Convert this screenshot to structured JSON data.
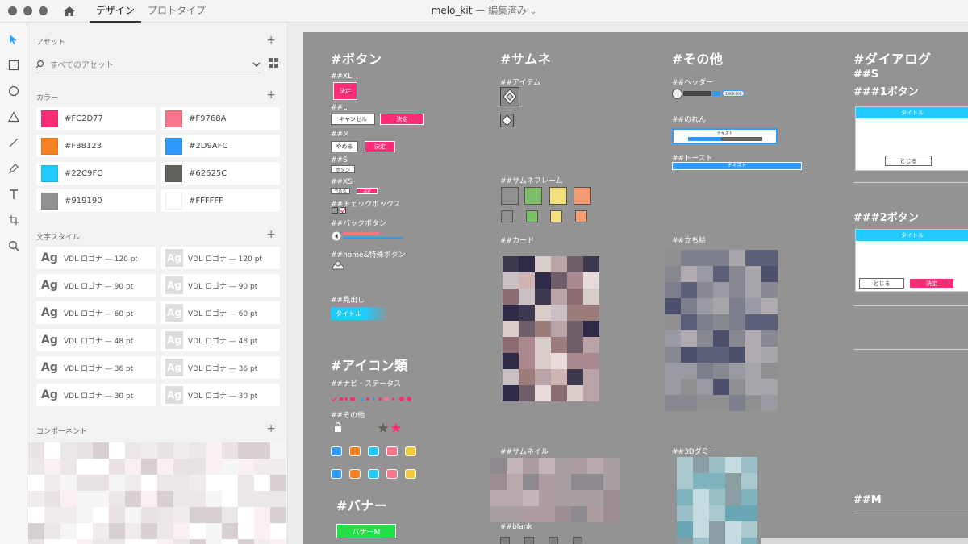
{
  "titlebar": {
    "tabs": [
      "デザイン",
      "プロトタイプ"
    ],
    "doc_name": "melo_kit",
    "separator": "—",
    "doc_state": "編集済み"
  },
  "tools": [
    "select-tool",
    "rectangle-tool",
    "ellipse-tool",
    "polygon-tool",
    "line-tool",
    "pen-tool",
    "text-tool",
    "artboard-tool",
    "zoom-tool"
  ],
  "panel": {
    "assets_title": "アセット",
    "search_placeholder": "すべてのアセット",
    "colors_title": "カラー",
    "colors": [
      {
        "hex": "#FC2D77"
      },
      {
        "hex": "#F9768A"
      },
      {
        "hex": "#F88123"
      },
      {
        "hex": "#2D9AFC"
      },
      {
        "hex": "#22C9FC"
      },
      {
        "hex": "#62625C"
      },
      {
        "hex": "#919190"
      },
      {
        "hex": "#FFFFFF"
      }
    ],
    "text_styles_title": "文字スタイル",
    "text_styles": [
      {
        "ag": "Ag",
        "label": "VDL ロゴナ — 120 pt"
      },
      {
        "ag": "Ag",
        "label": "VDL ロゴナ — 120 pt"
      },
      {
        "ag": "Ag",
        "label": "VDL ロゴナ — 90 pt"
      },
      {
        "ag": "Ag",
        "label": "VDL ロゴナ — 90 pt"
      },
      {
        "ag": "Ag",
        "label": "VDL ロゴナ — 60 pt"
      },
      {
        "ag": "Ag",
        "label": "VDL ロゴナ — 60 pt"
      },
      {
        "ag": "Ag",
        "label": "VDL ロゴナ — 48 pt"
      },
      {
        "ag": "Ag",
        "label": "VDL ロゴナ — 48 pt"
      },
      {
        "ag": "Ag",
        "label": "VDL ロゴナ — 36 pt"
      },
      {
        "ag": "Ag",
        "label": "VDL ロゴナ — 36 pt"
      },
      {
        "ag": "Ag",
        "label": "VDL ロゴナ — 30 pt"
      },
      {
        "ag": "Ag",
        "label": "VDL ロゴナ — 30 pt"
      }
    ],
    "components_title": "コンポーネント"
  },
  "canvas": {
    "button_section": {
      "title": "#ボタン",
      "xl": "##XL",
      "xl_btn": "決定",
      "l": "##L",
      "l_cancel": "キャンセル",
      "l_ok": "決定",
      "m": "##M",
      "m_stop": "やめる",
      "m_ok": "決定",
      "s": "##S",
      "s_btn": "ボタン",
      "xs": "##XS",
      "xs_stop": "やめる",
      "xs_ok": "決定",
      "checkbox": "##チェックボックス",
      "back": "##バックボタン",
      "home": "##home&特殊ボタン",
      "heading": "##見出し",
      "heading_label": "タイトル"
    },
    "icon_section": {
      "title": "#アイコン類",
      "nav": "##ナビ・ステータス",
      "other": "##その他"
    },
    "banner_section": {
      "title": "#バナー",
      "banner_label": "バナーM"
    },
    "thumb_section": {
      "title": "#サムネ",
      "item": "##アイテム",
      "frame": "##サムネフレーム",
      "card": "##カード",
      "thumbnail": "##サムネイル",
      "blank": "##blank"
    },
    "other_section": {
      "title": "#その他",
      "header": "##ヘッダー",
      "header_count": "1,000,000",
      "noren": "##のれん",
      "noren_text": "テキスト",
      "toast": "##トースト",
      "toast_text": "テキスト",
      "standing": "##立ち絵",
      "dummy3d": "##3Dダミー"
    },
    "dialog_section": {
      "title": "#ダイアログ",
      "s": "##S",
      "one_btn": "###1ボタン",
      "two_btn": "###2ボタン",
      "m": "##M",
      "dialog_title": "タイトル",
      "close": "とじる",
      "ok": "決定"
    }
  }
}
